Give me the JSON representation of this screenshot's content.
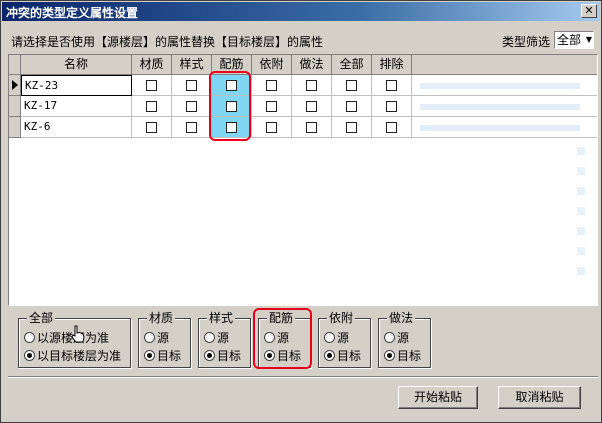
{
  "window": {
    "title": "冲突的类型定义属性设置",
    "close_label": "✕"
  },
  "prompt": "请选择是否使用【源楼层】的属性替换【目标楼层】的属性",
  "filter": {
    "label": "类型筛选",
    "value": "全部"
  },
  "table": {
    "columns": [
      "名称",
      "材质",
      "样式",
      "配筋",
      "依附",
      "做法",
      "全部",
      "排除"
    ],
    "rows": [
      {
        "name": "KZ-23",
        "current": true
      },
      {
        "name": "KZ-17",
        "current": false
      },
      {
        "name": "KZ-6",
        "current": false
      }
    ]
  },
  "groups": [
    {
      "title": "全部",
      "options": [
        "以源楼层为准",
        "以目标楼层为准"
      ],
      "selected": 1
    },
    {
      "title": "材质",
      "options": [
        "源",
        "目标"
      ],
      "selected": 1
    },
    {
      "title": "样式",
      "options": [
        "源",
        "目标"
      ],
      "selected": 1
    },
    {
      "title": "配筋",
      "options": [
        "源",
        "目标"
      ],
      "selected": 1
    },
    {
      "title": "依附",
      "options": [
        "源",
        "目标"
      ],
      "selected": 1
    },
    {
      "title": "做法",
      "options": [
        "源",
        "目标"
      ],
      "selected": 1
    }
  ],
  "buttons": {
    "start_paste": "开始粘贴",
    "cancel_paste": "取消粘贴"
  },
  "colors": {
    "highlight": "#e8001c",
    "selected_column": "#7fd6f2",
    "title_bar": "#0a246a"
  }
}
